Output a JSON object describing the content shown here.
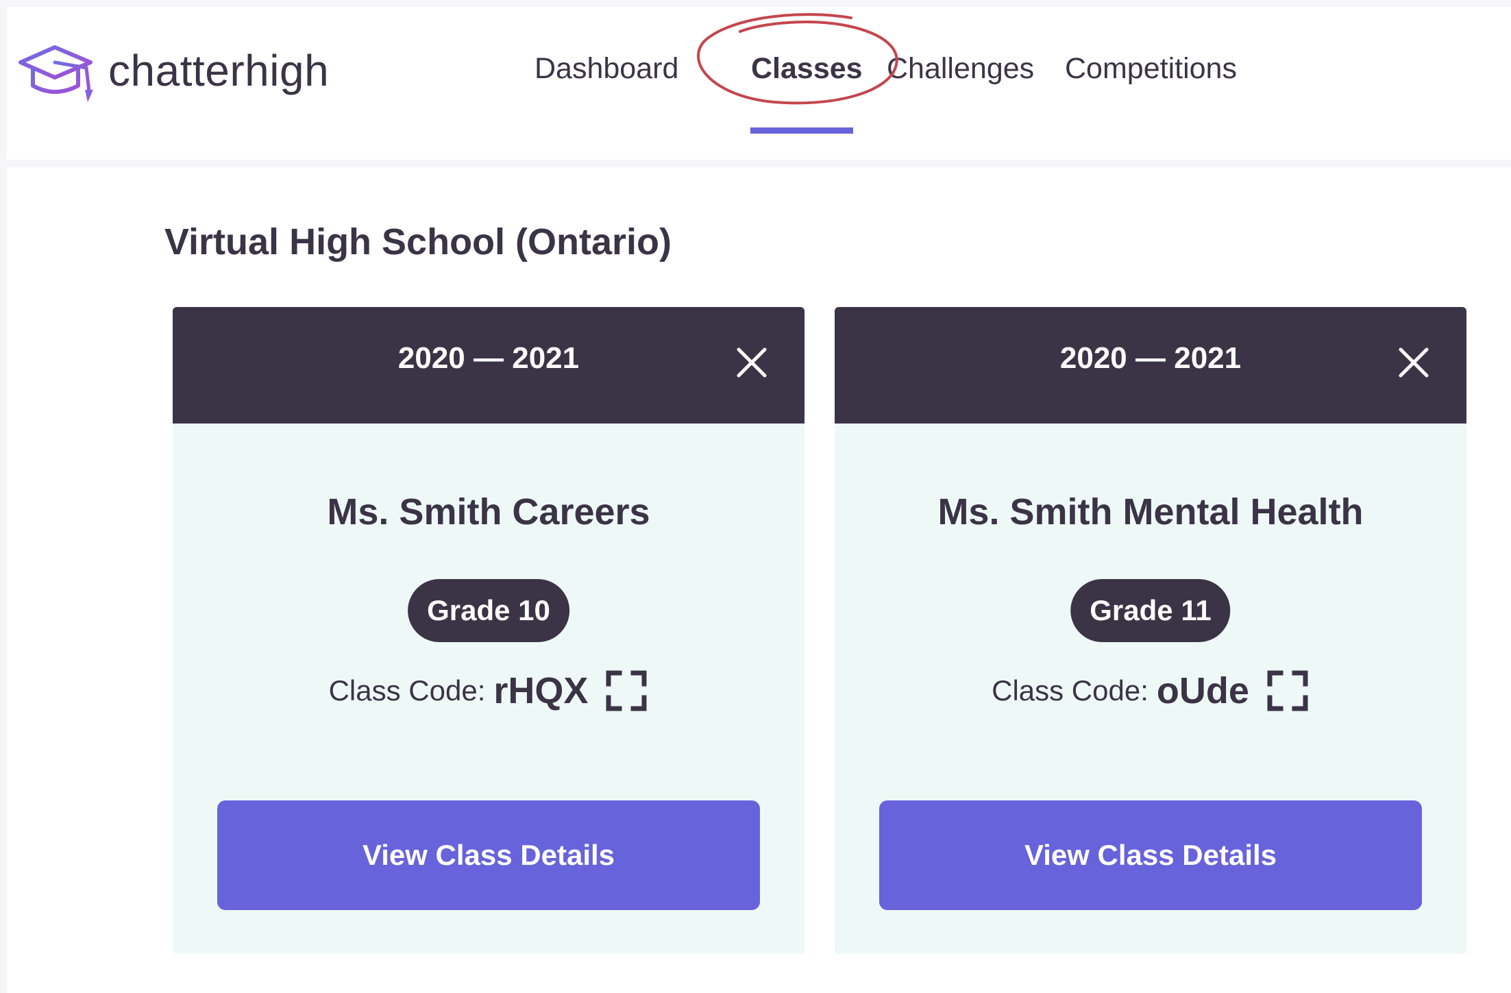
{
  "app": {
    "name": "chatterhigh"
  },
  "nav": {
    "items": [
      {
        "label": "Dashboard"
      },
      {
        "label": "Classes",
        "active": true
      },
      {
        "label": "Challenges"
      },
      {
        "label": "Competitions"
      }
    ]
  },
  "page": {
    "school_title": "Virtual High School (Ontario)"
  },
  "classes": [
    {
      "year": "2020 — 2021",
      "title": "Ms. Smith Careers",
      "grade": "Grade 10",
      "code_label": "Class Code:",
      "code": "rHQX",
      "button": "View Class Details"
    },
    {
      "year": "2020 — 2021",
      "title": "Ms. Smith Mental Health",
      "grade": "Grade 11",
      "code_label": "Class Code:",
      "code": "oUde",
      "button": "View Class Details"
    }
  ],
  "colors": {
    "accent": "#6763db",
    "dark": "#3b3346",
    "card_bg": "#eef9f7",
    "annotation": "#c4464d"
  },
  "icons": {
    "logo": "graduation-cap-icon",
    "close": "close-icon",
    "code_expand": "qr-scan-icon"
  }
}
